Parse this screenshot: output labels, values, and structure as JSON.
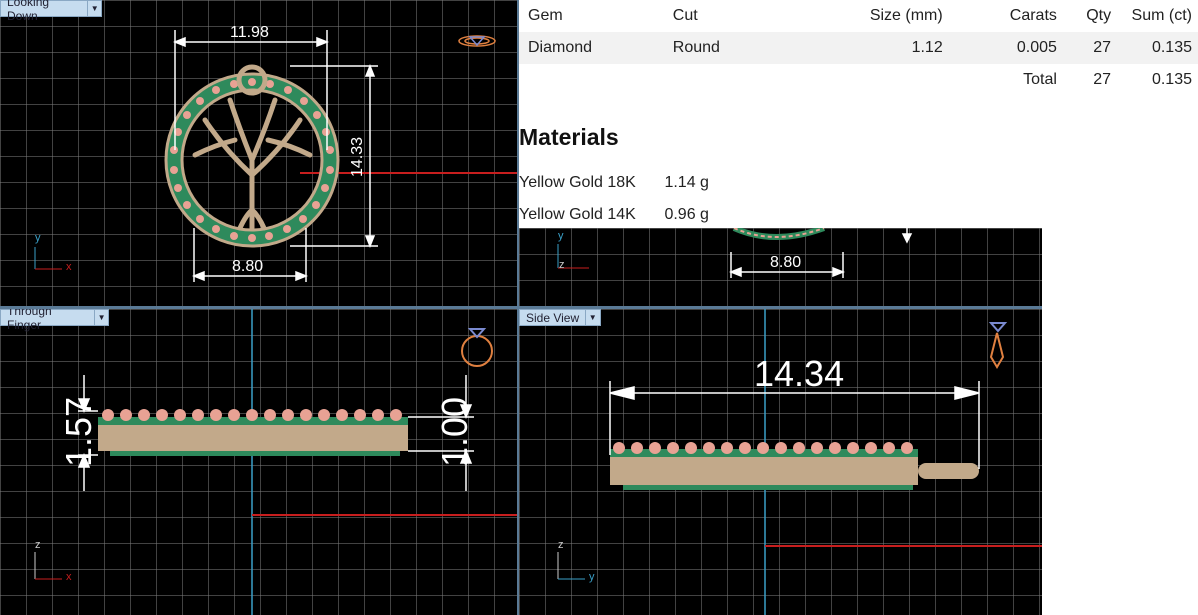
{
  "viewports": {
    "top_left": {
      "label": "Looking Down",
      "dims": {
        "width": "11.98",
        "height": "14.33",
        "bail_width": "8.80"
      },
      "axes": {
        "a": "y",
        "b": "x"
      }
    },
    "bottom_left": {
      "label": "Through Finger",
      "dims": {
        "left": "1.57",
        "right": "1.00"
      },
      "axes": {
        "a": "z",
        "b": "x"
      }
    },
    "bottom_right": {
      "label": "Side View",
      "dims": {
        "length": "14.34"
      },
      "axes": {
        "a": "z",
        "b": "y"
      }
    },
    "mid_right": {
      "dims": {
        "bail_width": "8.80"
      },
      "axes": {
        "a": "y",
        "b": "z"
      }
    }
  },
  "gem_table": {
    "headers": [
      "Gem",
      "Cut",
      "Size (mm)",
      "Carats",
      "Qty",
      "Sum (ct)"
    ],
    "rows": [
      {
        "gem": "Diamond",
        "cut": "Round",
        "size": "1.12",
        "carats": "0.005",
        "qty": "27",
        "sum": "0.135"
      }
    ],
    "total": {
      "label": "Total",
      "qty": "27",
      "sum": "0.135"
    }
  },
  "materials": {
    "title": "Materials",
    "items": [
      {
        "name": "Yellow Gold 18K",
        "weight": "1.14 g"
      },
      {
        "name": "Yellow Gold 14K",
        "weight": "0.96 g"
      }
    ]
  },
  "colors": {
    "background": "#000000",
    "grid": "#787878",
    "dimension": "#ffffff",
    "metal": "#c2a98a",
    "gem_green": "#2e8a5c",
    "gem_pink": "#e8a294",
    "axis_red": "#c81e1e",
    "axis_cyan": "#3aa0c8",
    "label_bg": "#c6dcef"
  }
}
